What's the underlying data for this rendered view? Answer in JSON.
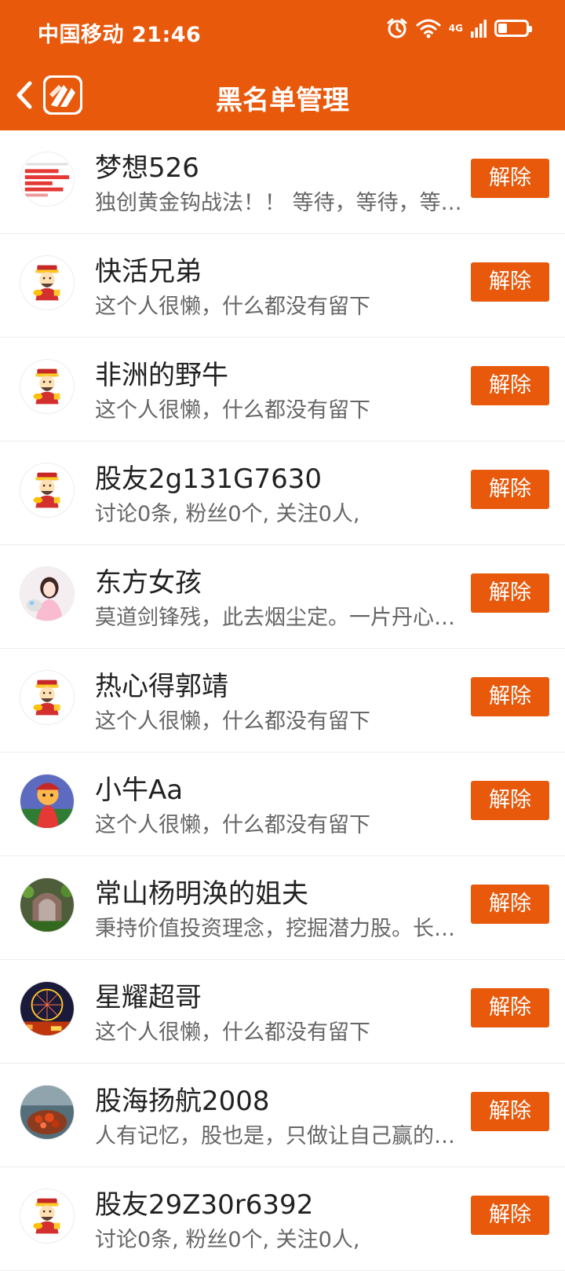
{
  "status_bar": {
    "carrier_time": "中国移动 21:46",
    "network_label": "4G",
    "battery_level": 0.3,
    "icons": [
      "alarm-icon",
      "wifi-icon",
      "cellular-signal-icon",
      "battery-icon"
    ]
  },
  "nav": {
    "title": "黑名单管理",
    "back_icon": "back-arrow-icon",
    "logo_icon": "app-logo-icon"
  },
  "colors": {
    "brand": "#e8590c",
    "button_text": "#ffffff",
    "name_text": "#222222",
    "desc_text": "#666666",
    "divider": "#ededed"
  },
  "button_label": "解除",
  "users": [
    {
      "name": "梦想526",
      "desc": "独创黄金钩战法！！ 等待，等待，等待再等待",
      "avatar": "screenshot-chart-avatar"
    },
    {
      "name": "快活兄弟",
      "desc": "这个人很懒，什么都没有留下",
      "avatar": "fortune-god-avatar"
    },
    {
      "name": "非洲的野牛",
      "desc": "这个人很懒，什么都没有留下",
      "avatar": "fortune-god-avatar"
    },
    {
      "name": "股友2g131G7630",
      "desc": "讨论0条, 粉丝0个, 关注0人,",
      "avatar": "fortune-god-avatar"
    },
    {
      "name": "东方女孩",
      "desc": "莫道剑锋残，此去烟尘定。一片丹心照汗青",
      "avatar": "girl-photo-avatar"
    },
    {
      "name": "热心得郭靖",
      "desc": "这个人很懒，什么都没有留下",
      "avatar": "fortune-god-avatar"
    },
    {
      "name": "小牛Aa",
      "desc": "这个人很懒，什么都没有留下",
      "avatar": "cartoon-character-avatar"
    },
    {
      "name": "常山杨明涣的姐夫",
      "desc": "秉持价值投资理念，挖掘潜力股。长期持有",
      "avatar": "archway-photo-avatar"
    },
    {
      "name": "星耀超哥",
      "desc": "这个人很懒，什么都没有留下",
      "avatar": "ferris-wheel-avatar"
    },
    {
      "name": "股海扬航2008",
      "desc": "人有记忆，股也是，只做让自己赢的交易",
      "avatar": "food-photo-avatar"
    },
    {
      "name": "股友29Z30r6392",
      "desc": "讨论0条, 粉丝0个, 关注0人,",
      "avatar": "fortune-god-avatar"
    }
  ]
}
